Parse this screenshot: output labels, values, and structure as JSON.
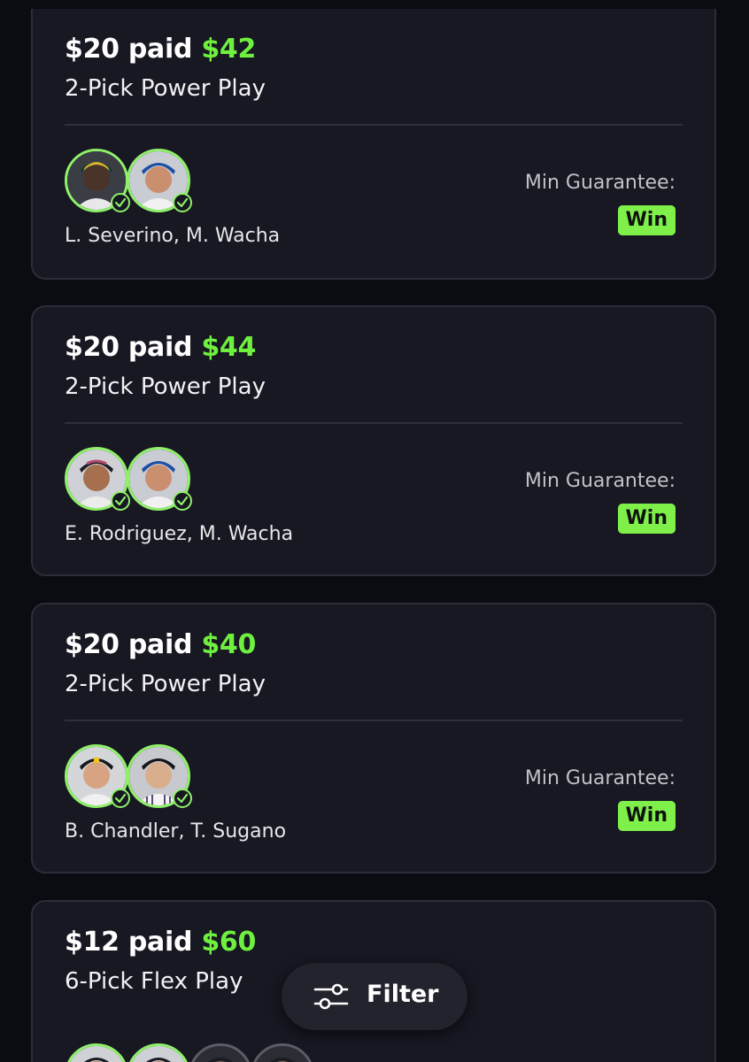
{
  "entries": [
    {
      "paid_text": "$20 paid",
      "payout": "$42",
      "play_type": "2-Pick Power Play",
      "players": "L. Severino, M. Wacha",
      "guarantee_label": "Min Guarantee:",
      "result": "Win"
    },
    {
      "paid_text": "$20 paid",
      "payout": "$44",
      "play_type": "2-Pick Power Play",
      "players": "E. Rodriguez, M. Wacha",
      "guarantee_label": "Min Guarantee:",
      "result": "Win"
    },
    {
      "paid_text": "$20 paid",
      "payout": "$40",
      "play_type": "2-Pick Power Play",
      "players": "B. Chandler, T. Sugano",
      "guarantee_label": "Min Guarantee:",
      "result": "Win"
    },
    {
      "paid_text": "$12 paid",
      "payout": "$60",
      "play_type": "6-Pick Flex Play"
    }
  ],
  "filter": {
    "label": "Filter",
    "icon": "sliders-icon"
  },
  "colors": {
    "background": "#0b0c12",
    "card": "#171822",
    "accent_green": "#6ff03f",
    "win_badge": "#7ff04a"
  }
}
